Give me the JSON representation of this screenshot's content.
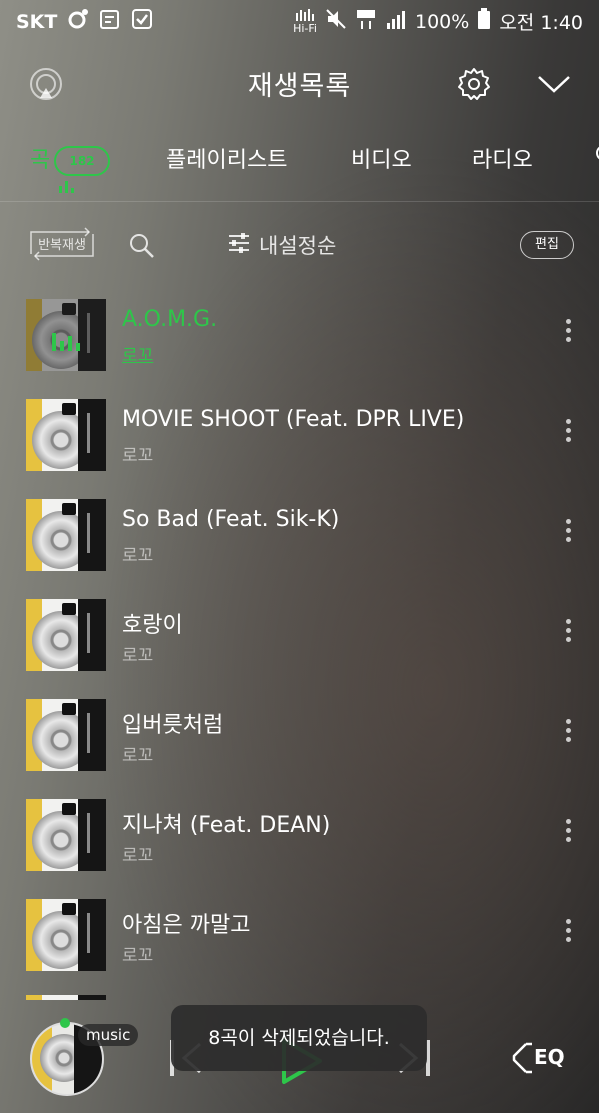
{
  "status_bar": {
    "carrier": "SKT",
    "hifi": "Hi-Fi",
    "battery": "100%",
    "time": "오전 1:40"
  },
  "header": {
    "title": "재생목록"
  },
  "tabs": [
    {
      "label": "곡",
      "count": "182",
      "active": true
    },
    {
      "label": "플레이리스트"
    },
    {
      "label": "비디오"
    },
    {
      "label": "라디오"
    }
  ],
  "toolbar": {
    "repeat_label": "반복재생",
    "sort_label": "내설정순",
    "edit_label": "편집"
  },
  "songs": [
    {
      "title": "A.O.M.G.",
      "artist": "로꼬",
      "playing": true
    },
    {
      "title": "MOVIE SHOOT (Feat. DPR LIVE)",
      "artist": "로꼬"
    },
    {
      "title": "So Bad (Feat. Sik-K)",
      "artist": "로꼬"
    },
    {
      "title": "호랑이",
      "artist": "로꼬"
    },
    {
      "title": "입버릇처럼",
      "artist": "로꼬"
    },
    {
      "title": "지나쳐 (Feat. DEAN)",
      "artist": "로꼬"
    },
    {
      "title": "아침은 까말고",
      "artist": "로꼬"
    }
  ],
  "player": {
    "tag": "music",
    "toast": "8곡이 삭제되었습니다.",
    "eq_label": "EQ"
  },
  "colors": {
    "accent": "#2ec64a"
  }
}
